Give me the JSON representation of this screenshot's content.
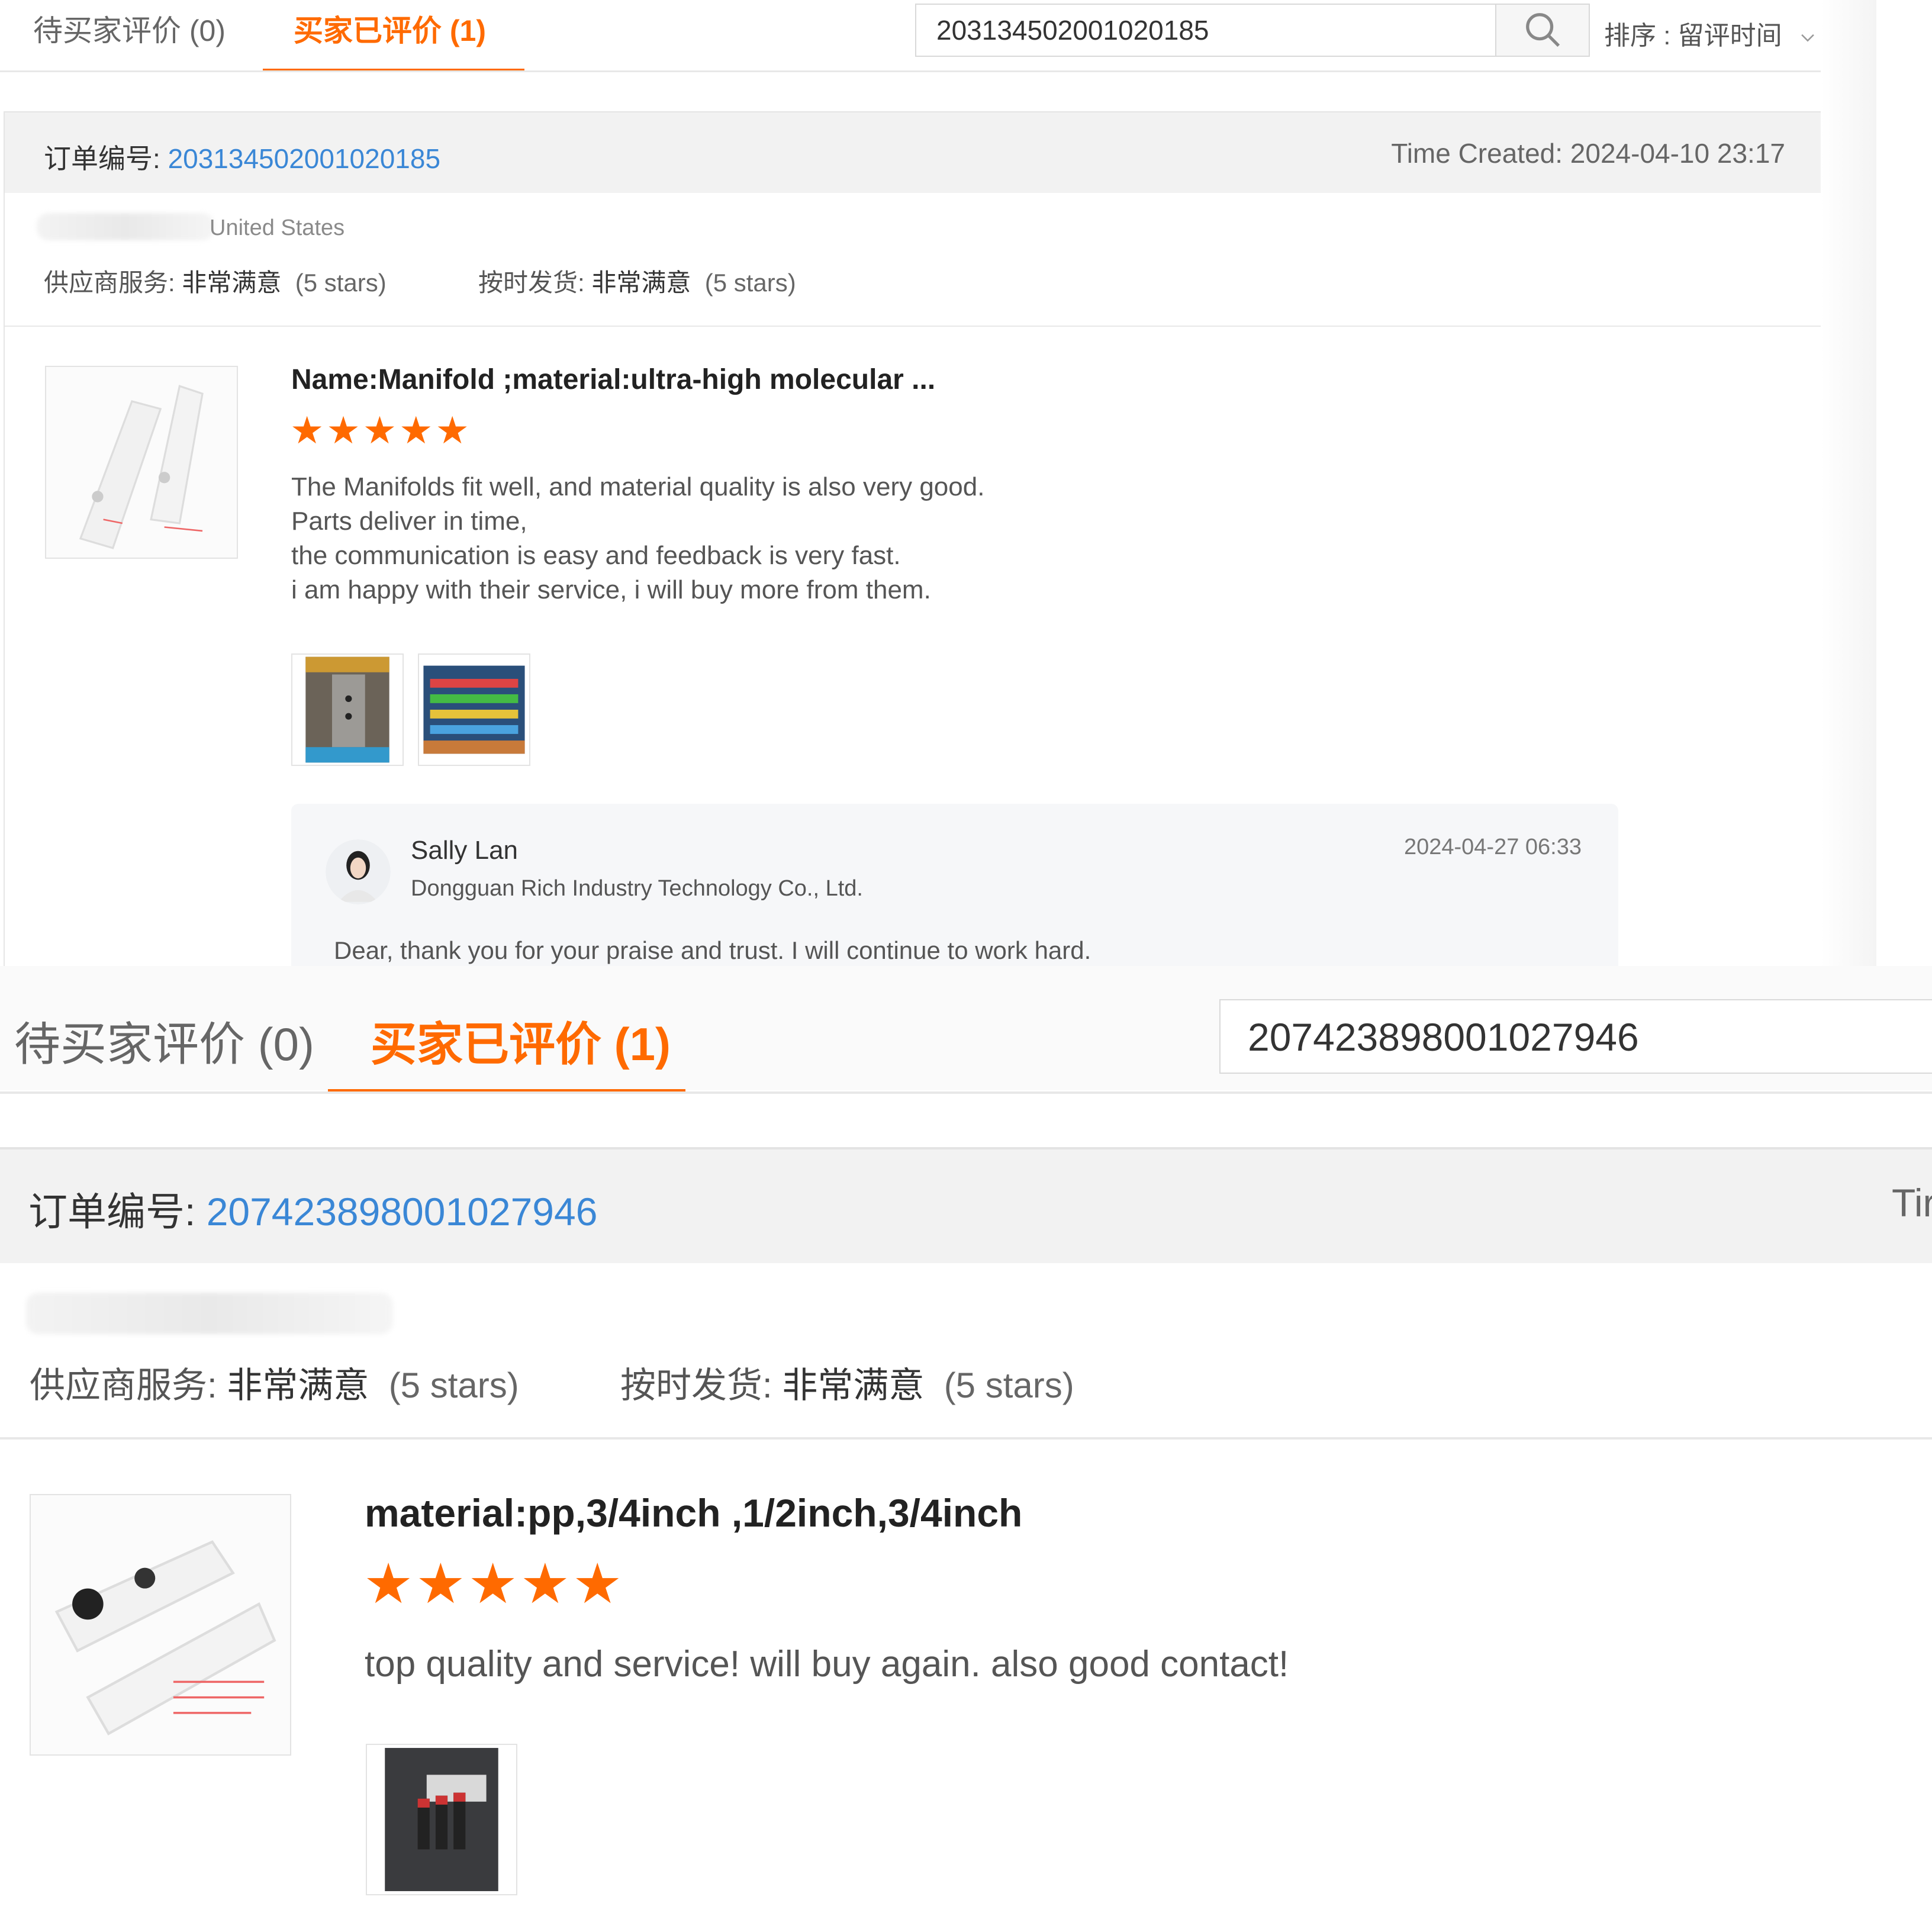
{
  "top": {
    "tabs": {
      "pending_label": "待买家评价 (0)",
      "done_label": "买家已评价 (1)"
    },
    "search": {
      "value": "203134502001020185"
    },
    "sort": {
      "label": "排序 : 留评时间"
    },
    "order": {
      "label": "订单编号: ",
      "number": "203134502001020185",
      "time_created": "Time Created: 2024-04-10 23:17",
      "country": "United States",
      "supplier_service": {
        "label": "供应商服务: ",
        "value": "非常满意",
        "stars": "(5 stars)"
      },
      "on_time": {
        "label": "按时发货: ",
        "value": "非常满意",
        "stars": "(5 stars)"
      },
      "product": {
        "name": "Name:Manifold ;material:ultra-high molecular ...",
        "rating": 5,
        "stars": "★★★★★",
        "review": "The Manifolds fit well, and material quality is also very good.\nParts deliver in time,\nthe communication is easy and feedback is very fast.\ni am happy with their service, i will buy more from them."
      },
      "reply": {
        "name": "Sally Lan",
        "company": "Dongguan Rich Industry Technology Co., Ltd.",
        "date": "2024-04-27 06:33",
        "text": "Dear, thank you for your praise and trust. I will continue to work hard."
      }
    }
  },
  "bottom": {
    "tabs": {
      "pending_label": "待买家评价 (0)",
      "done_label": "买家已评价 (1)"
    },
    "search": {
      "value": "207423898001027946"
    },
    "order": {
      "label": "订单编号: ",
      "number": "207423898001027946",
      "time_partial": "Tir",
      "supplier_service": {
        "label": "供应商服务: ",
        "value": "非常满意",
        "stars": "(5 stars)"
      },
      "on_time": {
        "label": "按时发货: ",
        "value": "非常满意",
        "stars": "(5 stars)"
      },
      "product": {
        "name": "material:pp,3/4inch ,1/2inch,3/4inch",
        "rating": 5,
        "stars": "★★★★★",
        "review": "top quality and service! will buy again. also good contact!"
      }
    }
  },
  "colors": {
    "accent": "#ff6a00",
    "link": "#3a87d6",
    "header_bg": "#f2f2f2"
  }
}
